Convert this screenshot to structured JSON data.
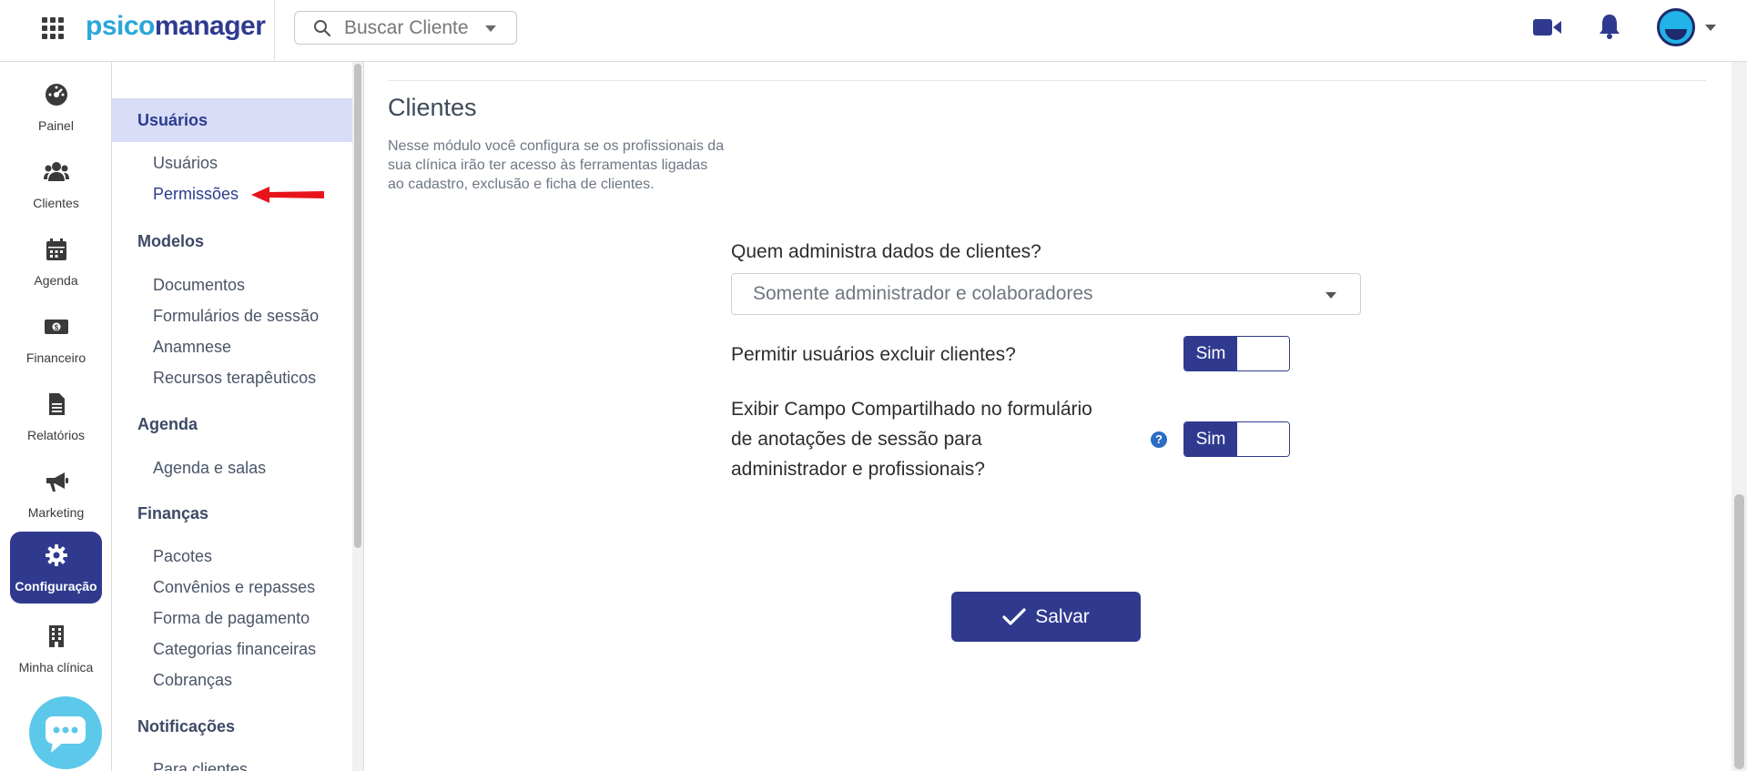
{
  "app": {
    "logo_part1": "psico",
    "logo_part2": "manager"
  },
  "search": {
    "placeholder": "Buscar Cliente"
  },
  "rail": {
    "items": [
      {
        "label": "Painel",
        "icon": "dashboard-icon"
      },
      {
        "label": "Clientes",
        "icon": "users-icon"
      },
      {
        "label": "Agenda",
        "icon": "calendar-icon"
      },
      {
        "label": "Financeiro",
        "icon": "money-icon"
      },
      {
        "label": "Relatórios",
        "icon": "document-icon"
      },
      {
        "label": "Marketing",
        "icon": "megaphone-icon"
      },
      {
        "label": "Configuração",
        "icon": "gear-icon",
        "active": true
      },
      {
        "label": "Minha clínica",
        "icon": "building-icon"
      }
    ]
  },
  "submenu": {
    "sections": [
      {
        "title": "Usuários",
        "links": [
          "Usuários",
          "Permissões"
        ]
      },
      {
        "title": "Modelos",
        "links": [
          "Documentos",
          "Formulários de sessão",
          "Anamnese",
          "Recursos terapêuticos"
        ]
      },
      {
        "title": "Agenda",
        "links": [
          "Agenda e salas"
        ]
      },
      {
        "title": "Finanças",
        "links": [
          "Pacotes",
          "Convênios e repasses",
          "Forma de pagamento",
          "Categorias financeiras",
          "Cobranças"
        ]
      },
      {
        "title": "Notificações",
        "links": [
          "Para clientes"
        ]
      }
    ]
  },
  "main": {
    "title": "Clientes",
    "description": "Nesse módulo você configura se os profissionais da sua clínica irão ter acesso às ferramentas ligadas ao cadastro, exclusão e ficha de clientes.",
    "q1": {
      "label": "Quem administra dados de clientes?",
      "value": "Somente administrador e colaboradores"
    },
    "q2": {
      "label": "Permitir usuários excluir clientes?",
      "toggle": "Sim"
    },
    "q3": {
      "label_line1": "Exibir Campo Compartilhado no formulário",
      "label_line2": "de anotações de sessão para",
      "label_line3": "administrador e profissionais?",
      "toggle": "Sim",
      "help": "?"
    },
    "save_label": "Salvar"
  },
  "colors": {
    "primary": "#2f3a8f",
    "accent": "#2aa7d9",
    "submenu_active_bg": "#d8dcf6",
    "arrow": "#e8141b"
  }
}
